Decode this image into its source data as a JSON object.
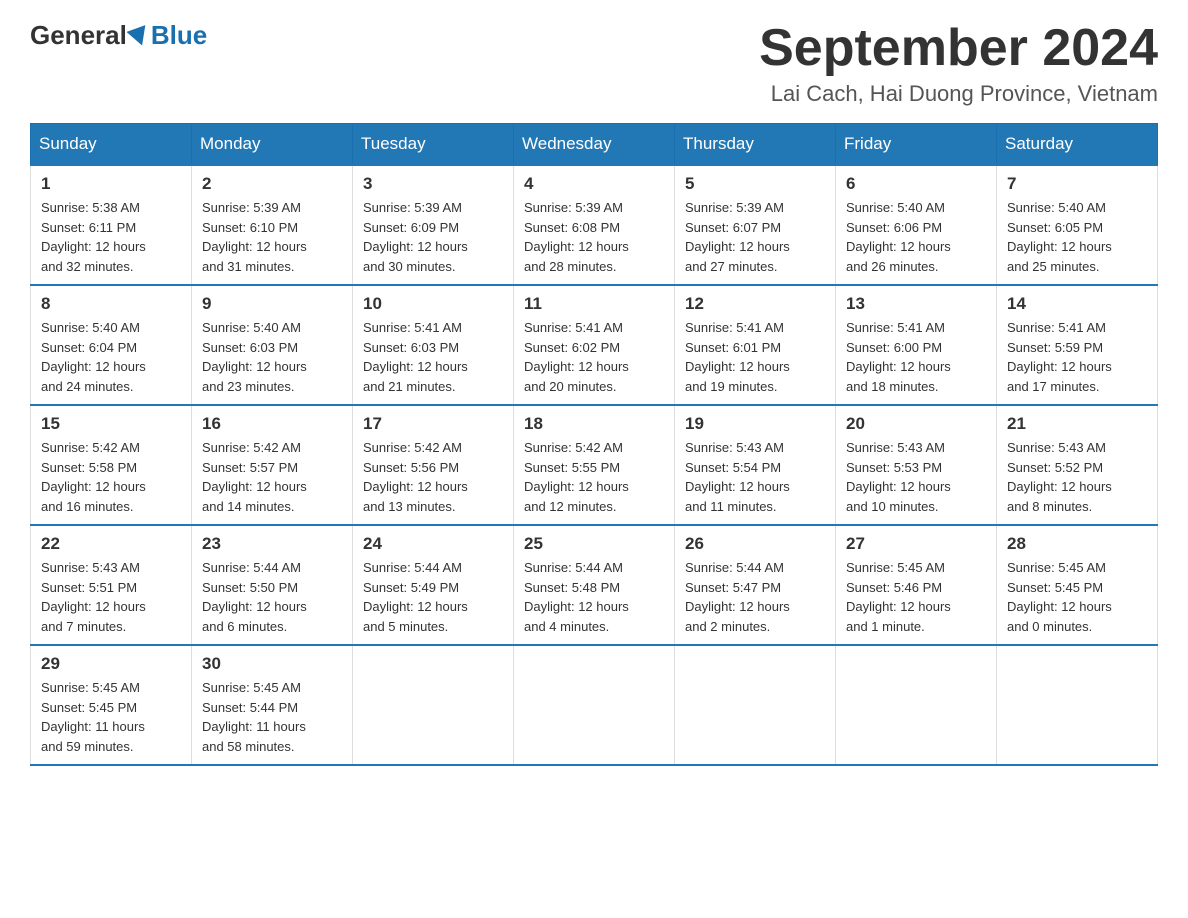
{
  "header": {
    "logo_general": "General",
    "logo_blue": "Blue",
    "month_title": "September 2024",
    "location": "Lai Cach, Hai Duong Province, Vietnam"
  },
  "weekdays": [
    "Sunday",
    "Monday",
    "Tuesday",
    "Wednesday",
    "Thursday",
    "Friday",
    "Saturday"
  ],
  "weeks": [
    [
      {
        "day": "1",
        "sunrise": "5:38 AM",
        "sunset": "6:11 PM",
        "daylight": "12 hours and 32 minutes."
      },
      {
        "day": "2",
        "sunrise": "5:39 AM",
        "sunset": "6:10 PM",
        "daylight": "12 hours and 31 minutes."
      },
      {
        "day": "3",
        "sunrise": "5:39 AM",
        "sunset": "6:09 PM",
        "daylight": "12 hours and 30 minutes."
      },
      {
        "day": "4",
        "sunrise": "5:39 AM",
        "sunset": "6:08 PM",
        "daylight": "12 hours and 28 minutes."
      },
      {
        "day": "5",
        "sunrise": "5:39 AM",
        "sunset": "6:07 PM",
        "daylight": "12 hours and 27 minutes."
      },
      {
        "day": "6",
        "sunrise": "5:40 AM",
        "sunset": "6:06 PM",
        "daylight": "12 hours and 26 minutes."
      },
      {
        "day": "7",
        "sunrise": "5:40 AM",
        "sunset": "6:05 PM",
        "daylight": "12 hours and 25 minutes."
      }
    ],
    [
      {
        "day": "8",
        "sunrise": "5:40 AM",
        "sunset": "6:04 PM",
        "daylight": "12 hours and 24 minutes."
      },
      {
        "day": "9",
        "sunrise": "5:40 AM",
        "sunset": "6:03 PM",
        "daylight": "12 hours and 23 minutes."
      },
      {
        "day": "10",
        "sunrise": "5:41 AM",
        "sunset": "6:03 PM",
        "daylight": "12 hours and 21 minutes."
      },
      {
        "day": "11",
        "sunrise": "5:41 AM",
        "sunset": "6:02 PM",
        "daylight": "12 hours and 20 minutes."
      },
      {
        "day": "12",
        "sunrise": "5:41 AM",
        "sunset": "6:01 PM",
        "daylight": "12 hours and 19 minutes."
      },
      {
        "day": "13",
        "sunrise": "5:41 AM",
        "sunset": "6:00 PM",
        "daylight": "12 hours and 18 minutes."
      },
      {
        "day": "14",
        "sunrise": "5:41 AM",
        "sunset": "5:59 PM",
        "daylight": "12 hours and 17 minutes."
      }
    ],
    [
      {
        "day": "15",
        "sunrise": "5:42 AM",
        "sunset": "5:58 PM",
        "daylight": "12 hours and 16 minutes."
      },
      {
        "day": "16",
        "sunrise": "5:42 AM",
        "sunset": "5:57 PM",
        "daylight": "12 hours and 14 minutes."
      },
      {
        "day": "17",
        "sunrise": "5:42 AM",
        "sunset": "5:56 PM",
        "daylight": "12 hours and 13 minutes."
      },
      {
        "day": "18",
        "sunrise": "5:42 AM",
        "sunset": "5:55 PM",
        "daylight": "12 hours and 12 minutes."
      },
      {
        "day": "19",
        "sunrise": "5:43 AM",
        "sunset": "5:54 PM",
        "daylight": "12 hours and 11 minutes."
      },
      {
        "day": "20",
        "sunrise": "5:43 AM",
        "sunset": "5:53 PM",
        "daylight": "12 hours and 10 minutes."
      },
      {
        "day": "21",
        "sunrise": "5:43 AM",
        "sunset": "5:52 PM",
        "daylight": "12 hours and 8 minutes."
      }
    ],
    [
      {
        "day": "22",
        "sunrise": "5:43 AM",
        "sunset": "5:51 PM",
        "daylight": "12 hours and 7 minutes."
      },
      {
        "day": "23",
        "sunrise": "5:44 AM",
        "sunset": "5:50 PM",
        "daylight": "12 hours and 6 minutes."
      },
      {
        "day": "24",
        "sunrise": "5:44 AM",
        "sunset": "5:49 PM",
        "daylight": "12 hours and 5 minutes."
      },
      {
        "day": "25",
        "sunrise": "5:44 AM",
        "sunset": "5:48 PM",
        "daylight": "12 hours and 4 minutes."
      },
      {
        "day": "26",
        "sunrise": "5:44 AM",
        "sunset": "5:47 PM",
        "daylight": "12 hours and 2 minutes."
      },
      {
        "day": "27",
        "sunrise": "5:45 AM",
        "sunset": "5:46 PM",
        "daylight": "12 hours and 1 minute."
      },
      {
        "day": "28",
        "sunrise": "5:45 AM",
        "sunset": "5:45 PM",
        "daylight": "12 hours and 0 minutes."
      }
    ],
    [
      {
        "day": "29",
        "sunrise": "5:45 AM",
        "sunset": "5:45 PM",
        "daylight": "11 hours and 59 minutes."
      },
      {
        "day": "30",
        "sunrise": "5:45 AM",
        "sunset": "5:44 PM",
        "daylight": "11 hours and 58 minutes."
      },
      null,
      null,
      null,
      null,
      null
    ]
  ],
  "labels": {
    "sunrise": "Sunrise:",
    "sunset": "Sunset:",
    "daylight": "Daylight:"
  }
}
